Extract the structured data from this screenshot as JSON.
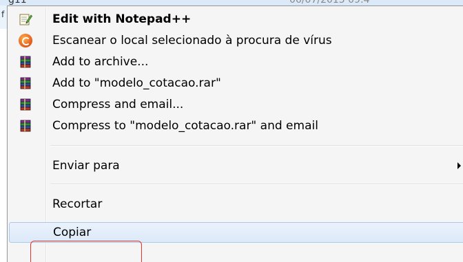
{
  "background": {
    "file_name_fragment": "g11",
    "date_fragment": "06/07/2015 09:4",
    "side_fragment_1": "ç",
    "side_fragment_2": "f"
  },
  "menu": {
    "items": [
      {
        "label": "Edit with Notepad++",
        "icon": "notepad-plus-plus-icon",
        "bold": true
      },
      {
        "label": "Escanear o local selecionado à procura de vírus",
        "icon": "antivirus-icon"
      },
      {
        "label": "Add to archive...",
        "icon": "winrar-icon"
      },
      {
        "label": "Add to \"modelo_cotacao.rar\"",
        "icon": "winrar-icon"
      },
      {
        "label": "Compress and email...",
        "icon": "winrar-icon"
      },
      {
        "label": "Compress to \"modelo_cotacao.rar\" and email",
        "icon": "winrar-icon"
      },
      {
        "label": "Enviar para",
        "has_submenu": true
      },
      {
        "label": "Recortar"
      },
      {
        "label": "Copiar",
        "highlighted": true
      }
    ]
  },
  "colors": {
    "annotation": "#e8302a",
    "hover_border": "#a8c8ec"
  }
}
